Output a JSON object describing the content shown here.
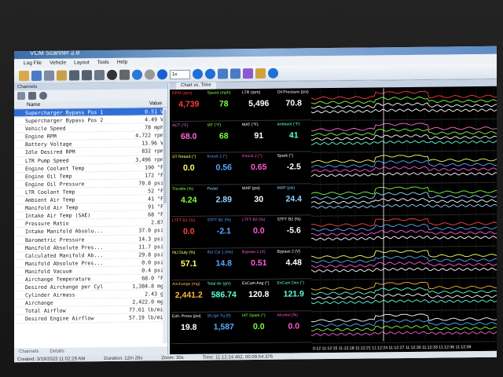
{
  "app": {
    "title": "VCM Scanner 2.8",
    "menu": [
      "Log File",
      "Vehicle",
      "Layout",
      "Tools",
      "Help"
    ],
    "zoom_select": "1x"
  },
  "channels": {
    "panel_title": "Channels",
    "col_name": "Name",
    "col_value": "Value",
    "rows": [
      {
        "name": "Supercharger Bypass Pos 1",
        "value": "0.51 V"
      },
      {
        "name": "Supercharger Bypass Pos 2",
        "value": "4.49 V"
      },
      {
        "name": "Vehicle Speed",
        "value": "78 mph"
      },
      {
        "name": "Engine RPM",
        "value": "4,722 rpm"
      },
      {
        "name": "Battery Voltage",
        "value": "13.96 V"
      },
      {
        "name": "Idle Desired RPM",
        "value": "832 rpm"
      },
      {
        "name": "LTR Pump Speed",
        "value": "3,496 rpm"
      },
      {
        "name": "Engine Coolant Temp",
        "value": "190 °F"
      },
      {
        "name": "Engine Oil Temp",
        "value": "172 °F"
      },
      {
        "name": "Engine Oil Pressure",
        "value": "70.8 psi"
      },
      {
        "name": "LTR Coolant Temp",
        "value": "52 °F"
      },
      {
        "name": "Ambient Air Temp",
        "value": "41 °F"
      },
      {
        "name": "Manifold Air Temp",
        "value": "91 °F"
      },
      {
        "name": "Intake Air Temp (SAE)",
        "value": "68 °F"
      },
      {
        "name": "Pressure Ratio",
        "value": "2.87"
      },
      {
        "name": "Intake Manifold Absolu...",
        "value": "37.0 psi"
      },
      {
        "name": "Barometric Pressure",
        "value": "14.3 psi"
      },
      {
        "name": "Manifold Absolute Pres...",
        "value": "11.7 psi"
      },
      {
        "name": "Calculated Manifold Ab...",
        "value": "29.8 psi"
      },
      {
        "name": "Manifold Absolute Pres...",
        "value": "0.0 psi"
      },
      {
        "name": "Manifold Vacuum",
        "value": "0.4 psi"
      },
      {
        "name": "Airchange Temperature",
        "value": "68.0 °F"
      },
      {
        "name": "Desired Airchange per Cyl",
        "value": "1,384.8 mg"
      },
      {
        "name": "Cylinder Airmass",
        "value": "2.43 g"
      },
      {
        "name": "Airchange",
        "value": "2,422.0 mg"
      },
      {
        "name": "Total Airflow",
        "value": "77.61 lb/min"
      },
      {
        "name": "Desired Engine Airflow",
        "value": "57.19 lb/min"
      }
    ],
    "footer_tabs": [
      "Channels",
      "Details"
    ]
  },
  "chart": {
    "tab_label": "Chart vs. Time",
    "groups": [
      [
        {
          "label": "RPM (rpm)",
          "value": "4,739",
          "color": "#ff3b3b"
        },
        {
          "label": "Speed (mph)",
          "value": "78",
          "color": "#7cff3b"
        },
        {
          "label": "LTR (rpm)",
          "value": "5,496",
          "color": "#ffffff"
        },
        {
          "label": "Oil Pressure (psi)",
          "value": "70.8",
          "color": "#ffffff"
        }
      ],
      [
        {
          "label": "ACT (°F)",
          "value": "68.0",
          "color": "#ff6ad5"
        },
        {
          "label": "IAT (°F)",
          "value": "68",
          "color": "#7cff3b"
        },
        {
          "label": "MAT (°F)",
          "value": "91",
          "color": "#ffffff"
        },
        {
          "label": "Ambient (°F)",
          "value": "41",
          "color": "#5fffd7"
        }
      ],
      [
        {
          "label": "ST Retard (°)",
          "value": "0.0",
          "color": "#ffff66"
        },
        {
          "label": "Knock 1 (°)",
          "value": "0.56",
          "color": "#5aa8ff"
        },
        {
          "label": "Knock 2 (°)",
          "value": "0.65",
          "color": "#ff5ad8"
        },
        {
          "label": "Spark (°)",
          "value": "-2.5",
          "color": "#ffffff"
        }
      ],
      [
        {
          "label": "Throttle (%)",
          "value": "4.24",
          "color": "#7cff3b"
        },
        {
          "label": "Pedal",
          "value": "2.89",
          "color": "#8fd4ff"
        },
        {
          "label": "MAP (psi)",
          "value": "30",
          "color": "#ffffff"
        },
        {
          "label": "MAP (psi)",
          "value": "24.4",
          "color": "#8fd4ff"
        }
      ],
      [
        {
          "label": "LTFT B1 (%)",
          "value": "0.0",
          "color": "#ff4444"
        },
        {
          "label": "STFT B1 (%)",
          "value": "-2.1",
          "color": "#5aa8ff"
        },
        {
          "label": "LTFT B2 (%)",
          "value": "0.0",
          "color": "#ff5ad8"
        },
        {
          "label": "STFT B2 (%)",
          "value": "-5.6",
          "color": "#ffffff"
        }
      ],
      [
        {
          "label": "INJ Duty (%)",
          "value": "57.1",
          "color": "#ffff66"
        },
        {
          "label": "INJ Cyl 1 (ms)",
          "value": "14.8",
          "color": "#5aa8ff"
        },
        {
          "label": "Bypass 1 (V)",
          "value": "0.51",
          "color": "#ff5ad8"
        },
        {
          "label": "Bypass 2 (V)",
          "value": "4.48",
          "color": "#ffffff"
        }
      ],
      [
        {
          "label": "Airchange (mg)",
          "value": "2,441.2",
          "color": "#ffb43b"
        },
        {
          "label": "Total Air (g/s)",
          "value": "586.74",
          "color": "#5fffd7"
        },
        {
          "label": "ExCam Ang (°)",
          "value": "120.8",
          "color": "#ffffff"
        },
        {
          "label": "ExCam Des (°)",
          "value": "121.9",
          "color": "#5fffd7"
        }
      ],
      [
        {
          "label": "Exh. Press (psi)",
          "value": "19.8",
          "color": "#ffffff"
        },
        {
          "label": "Sh.Ign Tq (ft)",
          "value": "1,587",
          "color": "#5aa8ff"
        },
        {
          "label": "IAT Spark (°)",
          "value": "0.0",
          "color": "#7cff3b"
        },
        {
          "label": "Alcohol (%)",
          "value": "0.0",
          "color": "#ff5ad8"
        }
      ]
    ],
    "time_axis": "0:12  11:12:15  11:12:18  11:12:21  11:12:24  11:12:27  11:12:30  11:12:33  11:12:36  11:12:39"
  },
  "status": {
    "created": "Created: 3/19/2023 11:02:29 AM",
    "duration": "Duration: 12m 26s",
    "zoom": "Zoom: 30s",
    "time": "Time: 11:12:24.462, 00:09:54.376"
  }
}
